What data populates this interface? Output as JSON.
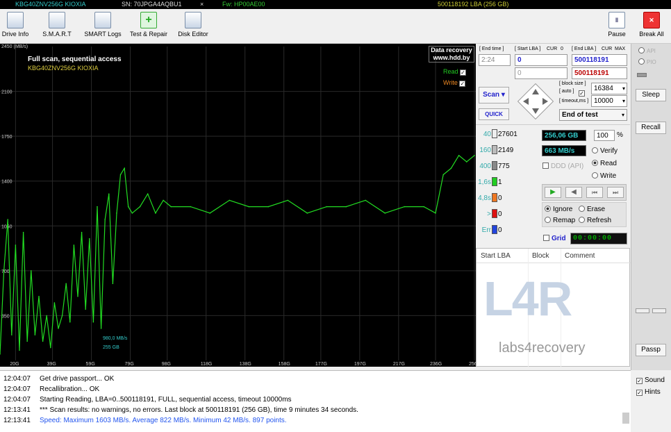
{
  "topbar": {
    "model": "KBG40ZNV256G KIOXIA",
    "sn": "SN: 70JPGA4AQBU1",
    "sep": "×",
    "fw": "Fw: HP00AE00",
    "lba": "500118192 LBA (256 GB)"
  },
  "toolbar": {
    "drive_info": "Drive Info",
    "smart": "S.M.A.R.T",
    "smart_logs": "SMART Logs",
    "test_repair": "Test & Repair",
    "disk_editor": "Disk Editor",
    "pause": "Pause",
    "break_all": "Break All"
  },
  "chart": {
    "title": "Full scan, sequential access",
    "drive": "KBG40ZNV256G KIOXIA",
    "ymax_label": "2450 (MB/s)",
    "dr_line1": "Data recovery",
    "dr_line2": "www.hdd.by",
    "read_label": "Read",
    "write_label": "Write",
    "marker1": "980,0 MB/s",
    "marker2": "255 GB",
    "colors": {
      "line": "#22dd22",
      "grid": "#2a2a2a",
      "axis": "#ccc",
      "title": "#ffffff",
      "drive": "#e0d040"
    }
  },
  "chart_data": {
    "type": "line",
    "title": "Full scan, sequential access",
    "ylabel": "(MB/s)",
    "ylim": [
      0,
      2450
    ],
    "y_ticks": [
      "2100",
      "1750",
      "1400",
      "1050",
      "700",
      "350"
    ],
    "y_tick_values": [
      2100,
      1750,
      1400,
      1050,
      700,
      350
    ],
    "x_ticks": [
      "20G",
      "39G",
      "59G",
      "79G",
      "98G",
      "118G",
      "138G",
      "158G",
      "177G",
      "197G",
      "217G",
      "236G",
      "256G"
    ],
    "x_tick_values": [
      20,
      39,
      59,
      79,
      98,
      118,
      138,
      158,
      177,
      197,
      217,
      236,
      256
    ],
    "xlim": [
      12,
      256
    ],
    "series": [
      {
        "name": "Read",
        "x": [
          12,
          14,
          16,
          18,
          20,
          22,
          24,
          26,
          28,
          30,
          32,
          34,
          36,
          38,
          40,
          42,
          44,
          46,
          48,
          50,
          52,
          54,
          56,
          58,
          60,
          62,
          64,
          66,
          68,
          70,
          72,
          74,
          76,
          78,
          80,
          84,
          88,
          92,
          96,
          100,
          110,
          120,
          130,
          140,
          150,
          160,
          170,
          180,
          190,
          200,
          210,
          220,
          230,
          236,
          240,
          244,
          248,
          252,
          256
        ],
        "values": [
          50,
          700,
          1100,
          200,
          900,
          80,
          1000,
          150,
          700,
          200,
          500,
          150,
          350,
          100,
          450,
          250,
          350,
          600,
          300,
          900,
          500,
          1000,
          400,
          950,
          300,
          1200,
          250,
          1100,
          1300,
          600,
          1150,
          1450,
          1500,
          1200,
          1150,
          1200,
          1300,
          1150,
          1250,
          1200,
          1200,
          1150,
          1250,
          1200,
          1200,
          1250,
          1150,
          1200,
          1200,
          1250,
          1150,
          1200,
          1200,
          1150,
          1450,
          1500,
          1600,
          1550,
          1600
        ]
      }
    ]
  },
  "ctrl": {
    "end_time_lbl": "[ End time ]",
    "end_time": "2:24",
    "start_lba_lbl": "[ Start LBA ]",
    "cur": "CUR",
    "zero": "0",
    "end_lba_lbl": "[ End LBA ]",
    "max": "MAX",
    "start_lba": "0",
    "start_lba2": "0",
    "end_lba": "500118191",
    "end_lba2": "500118191",
    "scan": "Scan",
    "quick": "QUICK",
    "block_size_lbl": "[ block size ]",
    "auto_lbl": "[ auto ]",
    "block_size": "16384",
    "timeout_lbl": "[ timeout,ms ]",
    "timeout": "10000",
    "end_of_test": "End of test",
    "gb": "256,06 GB",
    "pct": "100",
    "pct_sign": "%",
    "speed": "663 MB/s",
    "ddd": "DDD (API)",
    "verify": "Verify",
    "read": "Read",
    "write": "Write",
    "ignore": "Ignore",
    "erase": "Erase",
    "remap": "Remap",
    "refresh": "Refresh",
    "grid": "Grid",
    "timer": "00:00:00",
    "blocks": [
      {
        "t": "40",
        "v": "27601",
        "c": "#eeeeee"
      },
      {
        "t": "160",
        "v": "2149",
        "c": "#bbbbbb"
      },
      {
        "t": "400",
        "v": "775",
        "c": "#888888"
      },
      {
        "t": "1,6s",
        "v": "1",
        "c": "#22cc22"
      },
      {
        "t": "4,8s",
        "v": "0",
        "c": "#ee7722"
      },
      {
        "t": ">",
        "v": "0",
        "c": "#dd1111"
      },
      {
        "t": "Err",
        "v": "0",
        "c": "#2244dd"
      }
    ],
    "cols": {
      "start": "Start LBA",
      "block": "Block",
      "comment": "Comment"
    },
    "brand": "labs4recovery",
    "logo": "L4R"
  },
  "right": {
    "api": "API",
    "pio": "PIO",
    "sleep": "Sleep",
    "recall": "Recall",
    "passp": "Passp"
  },
  "log": [
    {
      "t": "12:04:07",
      "m": "Get drive passport... OK",
      "c": "#000"
    },
    {
      "t": "12:04:07",
      "m": "Recallibration... OK",
      "c": "#000"
    },
    {
      "t": "12:04:07",
      "m": "Starting Reading, LBA=0..500118191, FULL, sequential access, timeout 10000ms",
      "c": "#000"
    },
    {
      "t": "12:13:41",
      "m": "*** Scan results: no warnings, no errors. Last block at 500118191 (256 GB), time 9 minutes 34 seconds.",
      "c": "#000"
    },
    {
      "t": "12:13:41",
      "m": "Speed: Maximum 1603 MB/s. Average 822 MB/s. Minimum 42 MB/s. 897 points.",
      "c": "#2255ee"
    }
  ],
  "opts": {
    "sound": "Sound",
    "hints": "Hints"
  }
}
